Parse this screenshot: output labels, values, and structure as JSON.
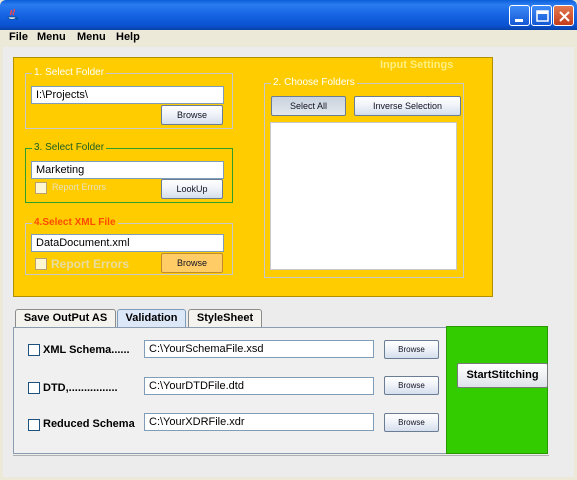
{
  "menubar": {
    "items": [
      "File",
      "Menu",
      "Menu",
      "Help"
    ]
  },
  "input_settings": {
    "heading": "Input Settings",
    "select_folder_1": {
      "title": "1. Select Folder",
      "value": "I:\\Projects\\",
      "browse_label": "Browse"
    },
    "choose_folders": {
      "title": "2. Choose Folders",
      "select_all_label": "Select All",
      "inverse_selection_label": "Inverse Selection"
    },
    "select_folder_3": {
      "title": "3. Select Folder",
      "value": "Marketing",
      "report_errors_label": "Report Errors",
      "lookup_label": "LookUp"
    },
    "select_xml_file": {
      "title": "4.Select XML File",
      "value": "DataDocument.xml",
      "report_errors_label": "Report Errors",
      "browse_label": "Browse"
    }
  },
  "tabs": [
    "Save OutPut AS",
    "Validation",
    "StyleSheet"
  ],
  "validation": {
    "rows": [
      {
        "label": "XML Schema......",
        "value": "C:\\YourSchemaFile.xsd",
        "browse_label": "Browse"
      },
      {
        "label": "DTD,................",
        "value": "C:\\YourDTDFile.dtd",
        "browse_label": "Browse"
      },
      {
        "label": "Reduced Schema",
        "value": "C:\\YourXDRFile.xdr",
        "browse_label": "Browse"
      }
    ]
  },
  "start_button_label": "StartStitching",
  "colors": {
    "panel": "#ffcc00",
    "action_panel": "#33cc00",
    "title_bar": "#0a52d0"
  }
}
